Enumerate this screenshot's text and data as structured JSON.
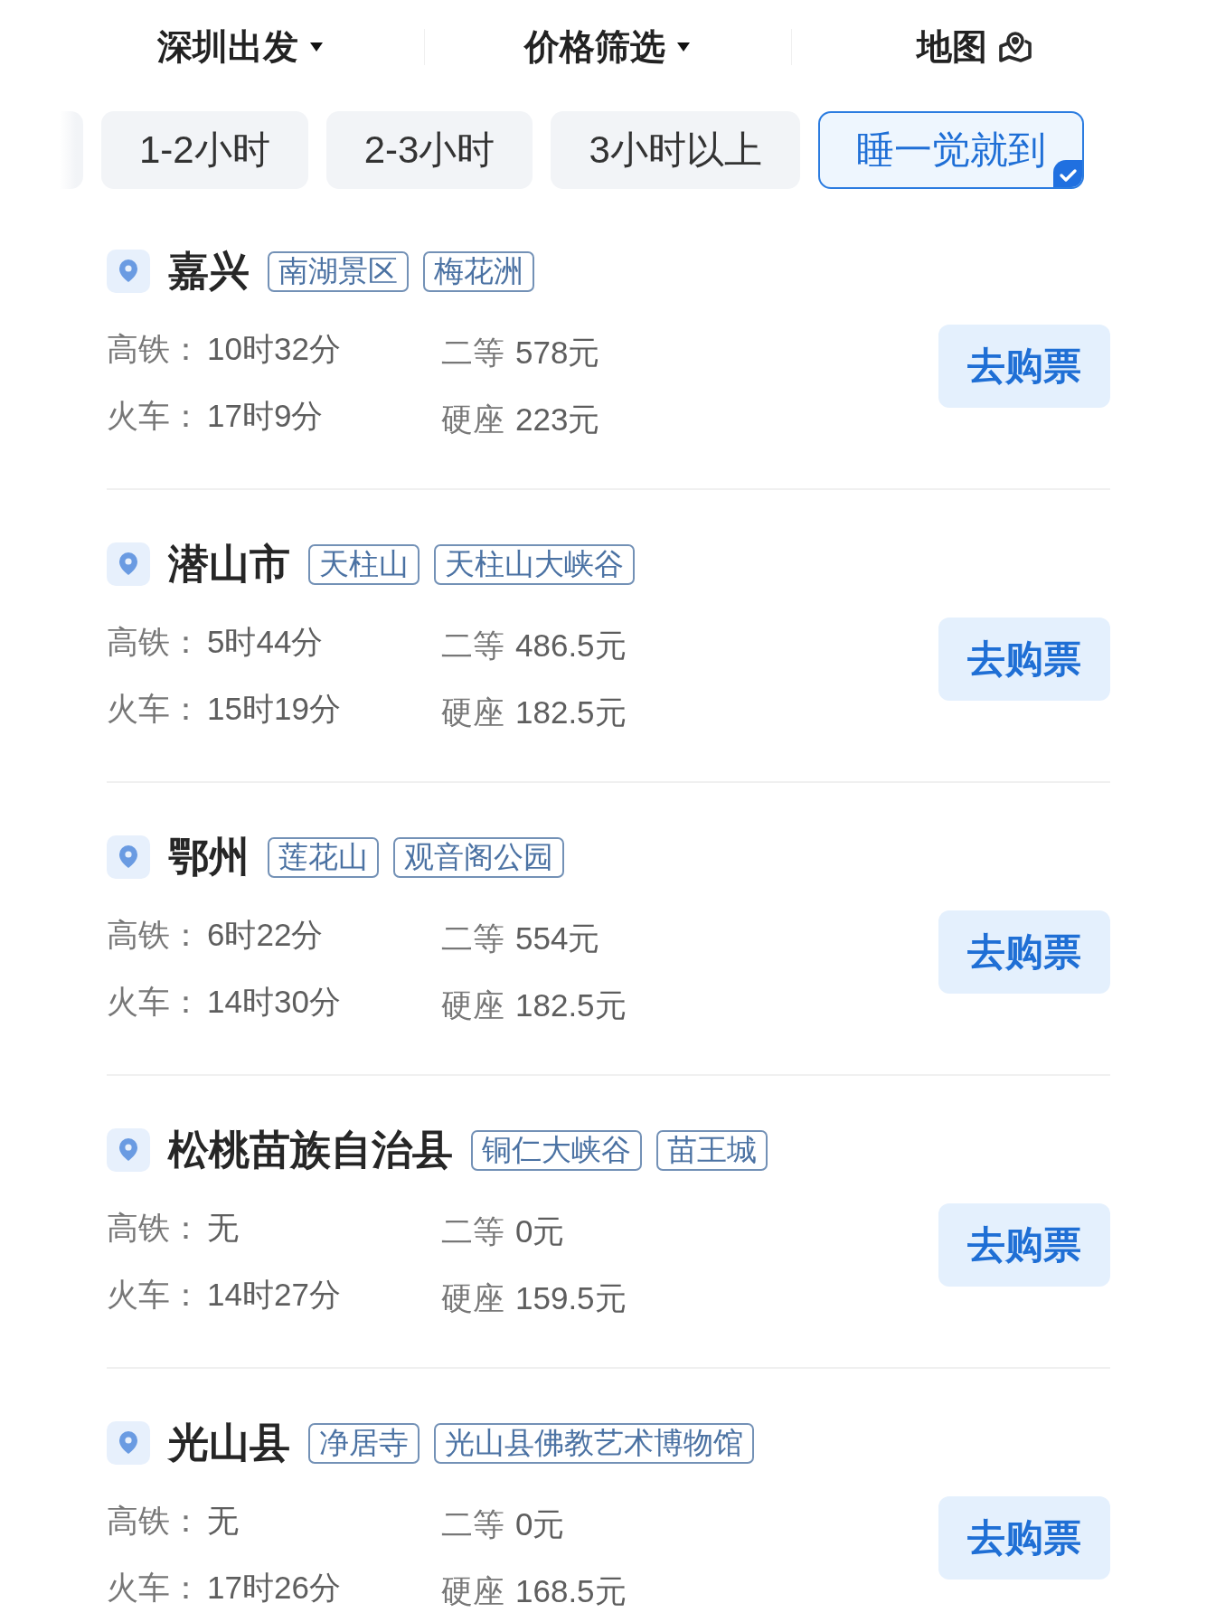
{
  "header": {
    "tabs": [
      {
        "label": "深圳出发",
        "kind": "dropdown"
      },
      {
        "label": "价格筛选",
        "kind": "dropdown"
      },
      {
        "label": "地图",
        "kind": "map"
      }
    ]
  },
  "duration_filters": [
    {
      "label": "1-2小时",
      "selected": false
    },
    {
      "label": "2-3小时",
      "selected": false
    },
    {
      "label": "3小时以上",
      "selected": false
    },
    {
      "label": "睡一觉就到",
      "selected": true
    }
  ],
  "destinations": [
    {
      "name": "嘉兴",
      "tags": [
        "南湖景区",
        "梅花洲"
      ],
      "times": [
        {
          "label": "高铁：",
          "value": "10时32分"
        },
        {
          "label": "火车：",
          "value": "17时9分"
        }
      ],
      "fares": [
        {
          "label": "二等",
          "value": "578元"
        },
        {
          "label": "硬座",
          "value": "223元"
        }
      ],
      "button": "去购票"
    },
    {
      "name": "潜山市",
      "tags": [
        "天柱山",
        "天柱山大峡谷"
      ],
      "times": [
        {
          "label": "高铁：",
          "value": "5时44分"
        },
        {
          "label": "火车：",
          "value": "15时19分"
        }
      ],
      "fares": [
        {
          "label": "二等",
          "value": "486.5元"
        },
        {
          "label": "硬座",
          "value": "182.5元"
        }
      ],
      "button": "去购票"
    },
    {
      "name": "鄂州",
      "tags": [
        "莲花山",
        "观音阁公园"
      ],
      "times": [
        {
          "label": "高铁：",
          "value": "6时22分"
        },
        {
          "label": "火车：",
          "value": "14时30分"
        }
      ],
      "fares": [
        {
          "label": "二等",
          "value": "554元"
        },
        {
          "label": "硬座",
          "value": "182.5元"
        }
      ],
      "button": "去购票"
    },
    {
      "name": "松桃苗族自治县",
      "tags": [
        "铜仁大峡谷",
        "苗王城"
      ],
      "times": [
        {
          "label": "高铁：",
          "value": "无"
        },
        {
          "label": "火车：",
          "value": "14时27分"
        }
      ],
      "fares": [
        {
          "label": "二等",
          "value": "0元"
        },
        {
          "label": "硬座",
          "value": "159.5元"
        }
      ],
      "button": "去购票"
    },
    {
      "name": "光山县",
      "tags": [
        "净居寺",
        "光山县佛教艺术博物馆"
      ],
      "times": [
        {
          "label": "高铁：",
          "value": "无"
        },
        {
          "label": "火车：",
          "value": "17时26分"
        }
      ],
      "fares": [
        {
          "label": "二等",
          "value": "0元"
        },
        {
          "label": "硬座",
          "value": "168.5元"
        }
      ],
      "button": "去购票"
    }
  ]
}
